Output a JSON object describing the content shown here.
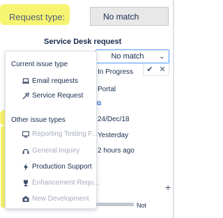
{
  "request_type": {
    "label": "Request type:",
    "value": "No match"
  },
  "service_desk_label": "Service Desk request",
  "inline_select": {
    "value": "No match",
    "confirm": "✔",
    "cancel": "✕"
  },
  "fields": {
    "status": "In Progress",
    "channel": "Portal",
    "created": "24/Dec/18",
    "updated": "Yesterday",
    "resolved_ago": "2 hours ago"
  },
  "dropdown": {
    "current_heading": "Current issue type",
    "current_items": [
      {
        "label": "Email requests",
        "icon": "laptop-icon"
      },
      {
        "label": "Service Request",
        "icon": "tools-icon"
      }
    ],
    "other_heading": "Other issue types",
    "other_items": [
      {
        "label": "Reporting Testing F...",
        "icon": "monitor-icon"
      },
      {
        "label": "General Inquiry",
        "icon": "headset-icon"
      },
      {
        "label": "Production Support",
        "icon": "bolt-icon"
      },
      {
        "label": "Enhancement Requ...",
        "icon": "trophy-icon"
      },
      {
        "label": "New Development",
        "icon": "camera-icon"
      }
    ]
  },
  "bottom": {
    "text": "Not"
  },
  "colors": {
    "highlight": "#f7f36a",
    "accent": "#4c9aff"
  }
}
